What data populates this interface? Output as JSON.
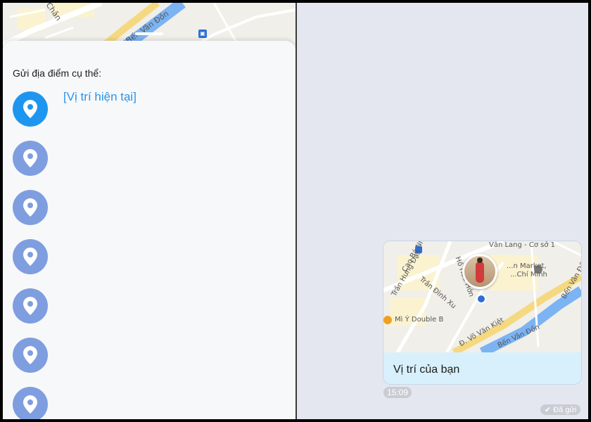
{
  "left_map": {
    "street_labels": [
      "Chân",
      "Bến Vân Đồn"
    ],
    "bus_stop_icon": "bus-icon"
  },
  "share_sheet": {
    "title": "Gửi địa điểm cụ thể:",
    "current_location_label": "[Vị trí hiện tại]",
    "location_icon": "map-pin-icon",
    "colors": {
      "active": "#1e96f0",
      "inactive": "#7f9ee0",
      "label": "#2a93e8"
    }
  },
  "chat": {
    "message": {
      "map_labels": [
        "Văn Lang - Cơ sở 1",
        "...n Market,",
        "...Chí Minh",
        "Trần Hưng Đạo",
        "Trần Đình Xu",
        "Mì Ý Double B",
        "Đ. Võ Văn Kiệt",
        "Bến Vân Đồn",
        "Bến Vân Đồn",
        "Hồ Hảo Hớn",
        "Cao Bá Nhạ"
      ],
      "caption": "Vị trí của bạn",
      "timestamp": "15:09"
    },
    "status": "Đã gửi",
    "status_icon": "check-icon"
  }
}
